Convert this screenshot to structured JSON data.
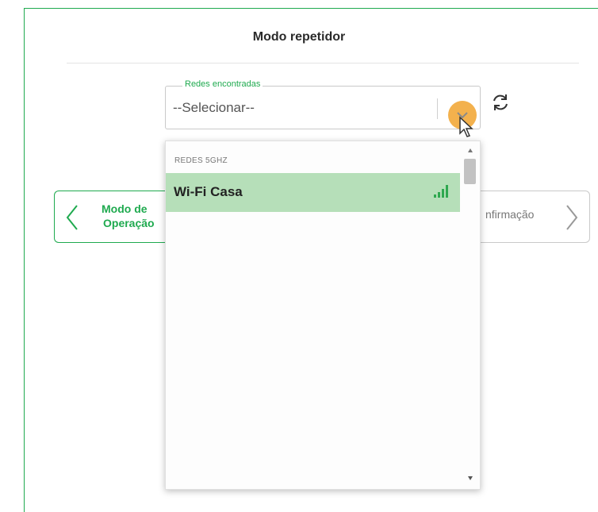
{
  "header": {
    "title": "Modo repetidor"
  },
  "network_select": {
    "legend": "Redes encontradas",
    "value": "--Selecionar--",
    "group_label": "REDES 5GHZ",
    "options": [
      {
        "label": "Wi-Fi Casa",
        "signal_icon": "wifi-signal-icon",
        "selected": true
      }
    ]
  },
  "nav": {
    "prev_label_line1": "Modo de",
    "prev_label_line2": "Operação",
    "next_label": "nfirmação"
  },
  "colors": {
    "accent": "#1faa4f",
    "highlight": "#b6dfb9",
    "chevron_bg": "#f3b14d"
  }
}
